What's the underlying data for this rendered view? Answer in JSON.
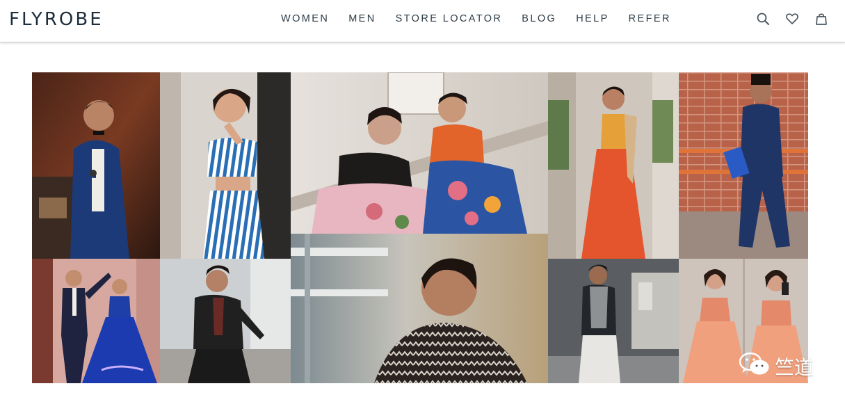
{
  "header": {
    "logo": "FLYROBE",
    "nav": [
      "WOMEN",
      "MEN",
      "STORE LOCATOR",
      "BLOG",
      "HELP",
      "REFER"
    ],
    "icons": [
      "search-icon",
      "heart-icon",
      "shopping-bag-icon"
    ]
  },
  "colors": {
    "logo": "#1d2d3c",
    "nav_text": "#2b3a44",
    "header_border": "#d8d8d8"
  },
  "collage": {
    "photos": [
      "man-in-blue-tuxedo-with-microphone",
      "woman-in-blue-white-striped-dress",
      "two-women-in-lehengas-on-stairs",
      "woman-in-orange-lehenga",
      "man-in-navy-bandhgala-suit",
      "couple-dancing-in-blue-outfits",
      "man-in-black-blazer-leaning",
      "man-in-printed-shirt-closeup",
      "man-in-grey-nehru-jacket",
      "woman-in-peach-gown-mirror-selfie"
    ]
  },
  "watermark": {
    "text": "竺道"
  }
}
